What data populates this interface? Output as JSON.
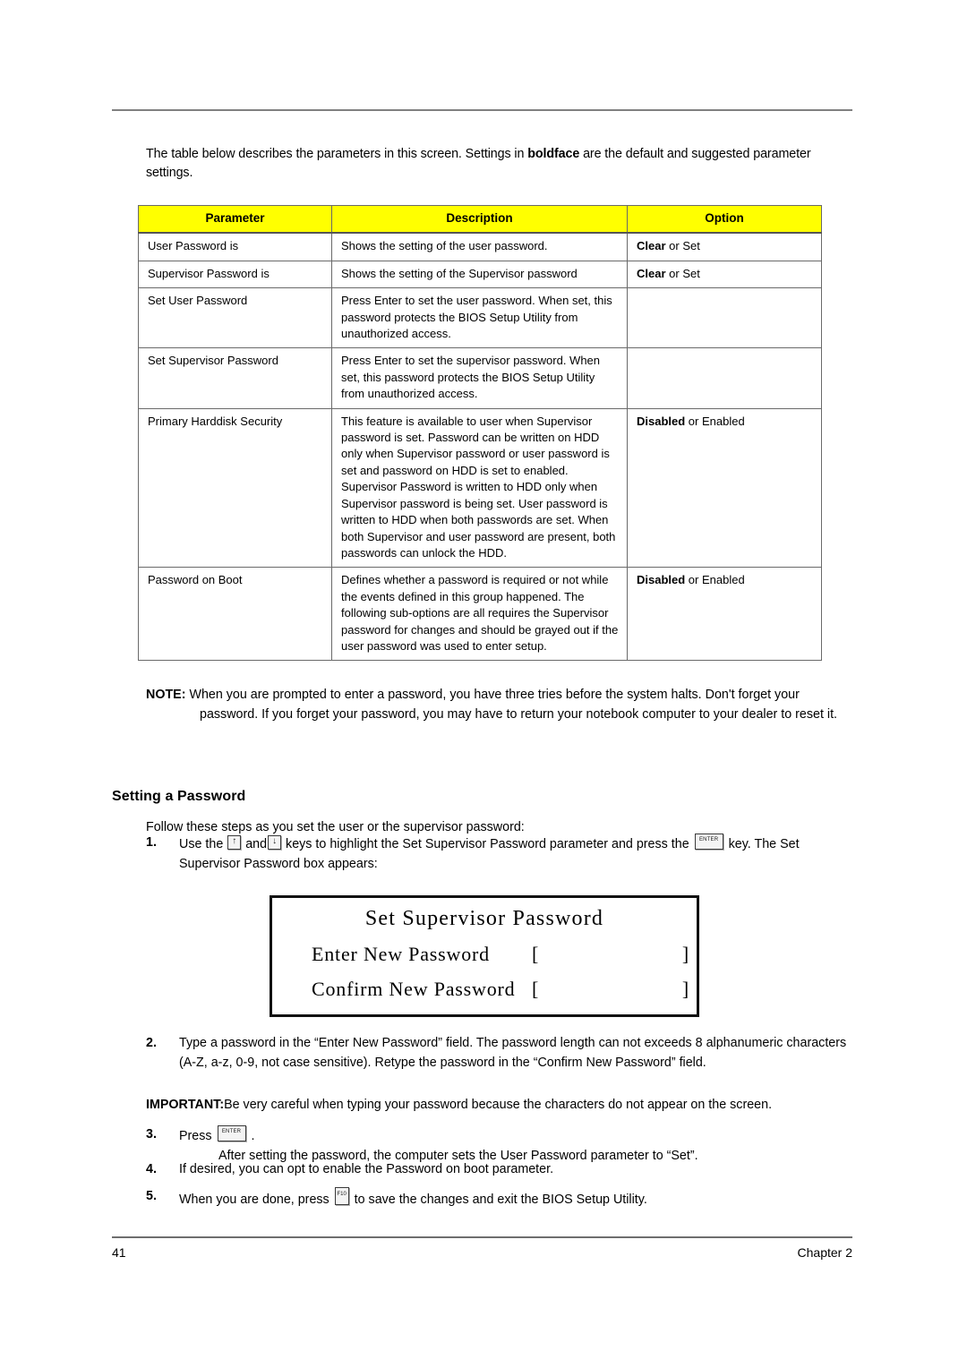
{
  "intro": {
    "text_before_bold": "The table below describes the parameters in this screen. Settings in ",
    "bold_word": "boldface",
    "text_after_bold": " are the default and suggested parameter settings."
  },
  "table": {
    "headers": [
      "Parameter",
      "Description",
      "Option"
    ],
    "header_bg": "#FFFF00",
    "rows": [
      {
        "parameter": "User Password is",
        "description": "Shows the setting of the user password.",
        "option_bold": "Clear",
        "option_rest": " or Set"
      },
      {
        "parameter": "Supervisor Password is",
        "description": "Shows the setting of the Supervisor password",
        "option_bold": "Clear",
        "option_rest": " or Set"
      },
      {
        "parameter": "Set User Password",
        "description": "Press Enter to set the user password. When set, this password protects the BIOS Setup Utility from unauthorized access.",
        "option_bold": "",
        "option_rest": ""
      },
      {
        "parameter": "Set Supervisor Password",
        "description": "Press Enter to set the supervisor password. When set, this password protects the BIOS Setup Utility from unauthorized access.",
        "option_bold": "",
        "option_rest": ""
      },
      {
        "parameter": "Primary Harddisk Security",
        "description": "This feature is available to user when Supervisor password is set. Password can be written on HDD only when Supervisor password or user password is set and password on HDD is set to enabled. Supervisor Password is written to HDD only when Supervisor password is being set. User password is written to HDD when both passwords are set. When both Supervisor and user password are present, both passwords can unlock the HDD.",
        "option_bold": "Disabled",
        "option_rest": " or Enabled"
      },
      {
        "parameter": "Password on Boot",
        "description": "Defines whether a password is required or not while the events defined in this group happened. The following sub-options are all requires the Supervisor password for changes and should be grayed out if the user password was used to enter setup.",
        "option_bold": "Disabled",
        "option_rest": " or Enabled"
      }
    ]
  },
  "note": {
    "label": "NOTE:",
    "body": "When you are prompted to enter a password, you have three tries before the system halts. Don't forget your password. If you forget your password, you may have to return your notebook computer to your dealer to reset it."
  },
  "section": {
    "heading": "Setting a Password",
    "lead_in": "Follow these steps as you set the user or the supervisor password:"
  },
  "steps": {
    "step1": {
      "num": "1.",
      "part1": "Use the ",
      "key_up": "↑",
      "part2": " and",
      "key_down": "↓",
      "part3": " keys to highlight the Set Supervisor Password parameter and press the ",
      "key_enter": "ENTER",
      "part4": " key. The Set Supervisor Password box appears:"
    },
    "step2": {
      "num": "2.",
      "text": "Type a password in the “Enter New Password” field. The password length can not exceeds 8 alphanumeric characters (A-Z, a-z, 0-9, not case sensitive). Retype the password in the “Confirm New Password” field."
    },
    "important": {
      "label": "IMPORTANT:",
      "text": "Be very careful when typing your password because the characters do not appear on the screen."
    },
    "step3": {
      "num": "3.",
      "part1": "Press ",
      "key_enter": "ENTER",
      "part2": " .",
      "sub": "After setting the password, the computer sets the User Password parameter to “Set”."
    },
    "step4": {
      "num": "4.",
      "text": "If desired, you can opt to enable the Password on boot parameter."
    },
    "step5": {
      "num": "5.",
      "part1": "When you are done, press ",
      "key_f10": "F10",
      "part2": " to save the changes and exit the BIOS Setup Utility."
    }
  },
  "bios_dialog": {
    "title": "Set Supervisor Password",
    "rows": [
      {
        "label": "Enter New Password",
        "bracket_open": "[",
        "value": "",
        "bracket_close": "]"
      },
      {
        "label": "Confirm New Password",
        "bracket_open": "[",
        "value": "",
        "bracket_close": "]"
      }
    ]
  },
  "footer": {
    "page_number": "41",
    "chapter": "Chapter 2"
  }
}
